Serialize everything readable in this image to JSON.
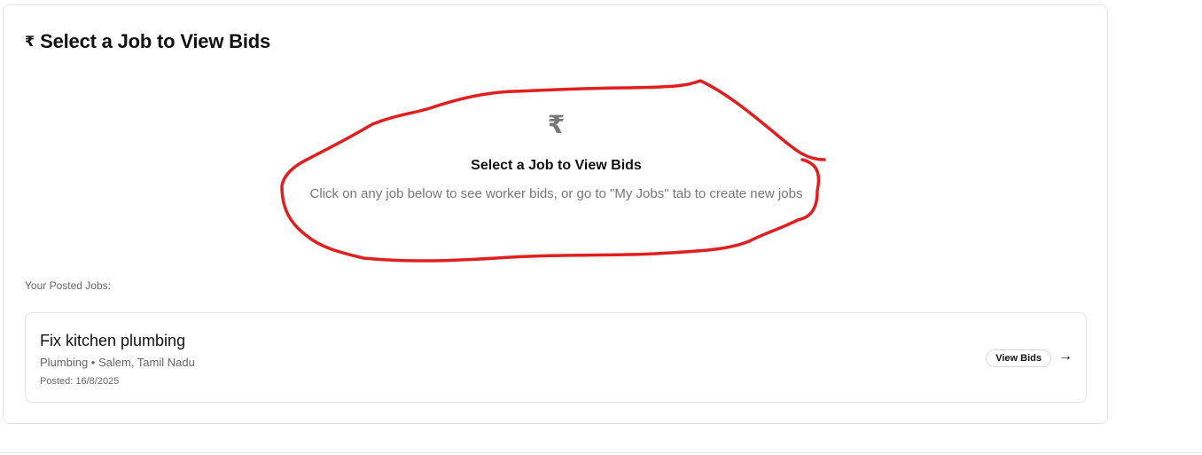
{
  "header": {
    "icon": "rupee-icon",
    "title": "Select a Job to View Bids"
  },
  "empty_state": {
    "icon": "rupee-icon",
    "title": "Select a Job to View Bids",
    "description": "Click on any job below to see worker bids, or go to \"My Jobs\" tab to create new jobs"
  },
  "posted_jobs": {
    "label": "Your Posted Jobs:",
    "items": [
      {
        "title": "Fix kitchen plumbing",
        "meta": "Plumbing • Salem, Tamil Nadu",
        "posted": "Posted: 16/8/2025",
        "action_label": "View Bids",
        "arrow_icon": "arrow-right-icon"
      }
    ]
  },
  "colors": {
    "annotation": "#e02020",
    "border": "#e6e6e6",
    "muted_text": "#777777"
  }
}
